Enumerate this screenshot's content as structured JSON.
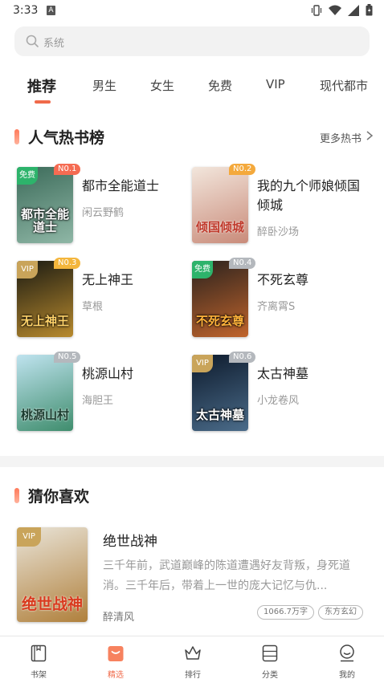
{
  "status": {
    "time": "3:33",
    "notification_icon": "A"
  },
  "search": {
    "placeholder": "系统"
  },
  "tabs": [
    {
      "label": "推荐",
      "active": true
    },
    {
      "label": "男生"
    },
    {
      "label": "女生"
    },
    {
      "label": "免费"
    },
    {
      "label": "VIP"
    },
    {
      "label": "现代都市"
    }
  ],
  "hot": {
    "title": "人气热书榜",
    "more": "更多热书",
    "books": [
      {
        "rank": "N0.1",
        "title": "都市全能道士",
        "author": "闲云野鹤",
        "tag": "免费",
        "cover_text": "都市全能道士",
        "cover_colors": [
          "#3c6b5a",
          "#8fb7a6"
        ]
      },
      {
        "rank": "N0.2",
        "title": "我的九个师娘倾国倾城",
        "author": "醉卧沙场",
        "tag": "",
        "cover_text": "倾国倾城",
        "cover_colors": [
          "#f2e6dc",
          "#c98b7a"
        ]
      },
      {
        "rank": "N0.3",
        "title": "无上神王",
        "author": "草根",
        "tag": "VIP",
        "cover_text": "无上神王",
        "cover_colors": [
          "#1a1a12",
          "#b88a2e"
        ]
      },
      {
        "rank": "N0.4",
        "title": "不死玄尊",
        "author": "齐离霄S",
        "tag": "免费",
        "cover_text": "不死玄尊",
        "cover_colors": [
          "#2a221e",
          "#c0642c"
        ]
      },
      {
        "rank": "N0.5",
        "title": "桃源山村",
        "author": "海胆王",
        "tag": "",
        "cover_text": "桃源山村",
        "cover_colors": [
          "#bfe3ef",
          "#3f8d6d"
        ]
      },
      {
        "rank": "N0.6",
        "title": "太古神墓",
        "author": "小龙卷风",
        "tag": "VIP",
        "cover_text": "太古神墓",
        "cover_colors": [
          "#0d1a2c",
          "#4b6c8a"
        ]
      }
    ]
  },
  "guess": {
    "title": "猜你喜欢",
    "book": {
      "title": "绝世战神",
      "desc": "三千年前，武道巅峰的陈道遭遇好友背叛，身死道消。三千年后，带着上一世的庞大记忆与仇...",
      "author": "醉清风",
      "word_count": "1066.7万字",
      "category": "东方玄幻",
      "tag": "VIP",
      "cover_text": "绝世战神",
      "cover_colors": [
        "#e9e4d8",
        "#b0803c"
      ]
    }
  },
  "nav": [
    {
      "label": "书架",
      "icon": "bookshelf-icon"
    },
    {
      "label": "精选",
      "icon": "featured-icon",
      "active": true
    },
    {
      "label": "排行",
      "icon": "ranking-crown-icon"
    },
    {
      "label": "分类",
      "icon": "category-icon"
    },
    {
      "label": "我的",
      "icon": "profile-icon"
    }
  ],
  "colors": {
    "accent": "#f06a4a",
    "free": "#2db36b",
    "vip": "#c9a45a"
  }
}
